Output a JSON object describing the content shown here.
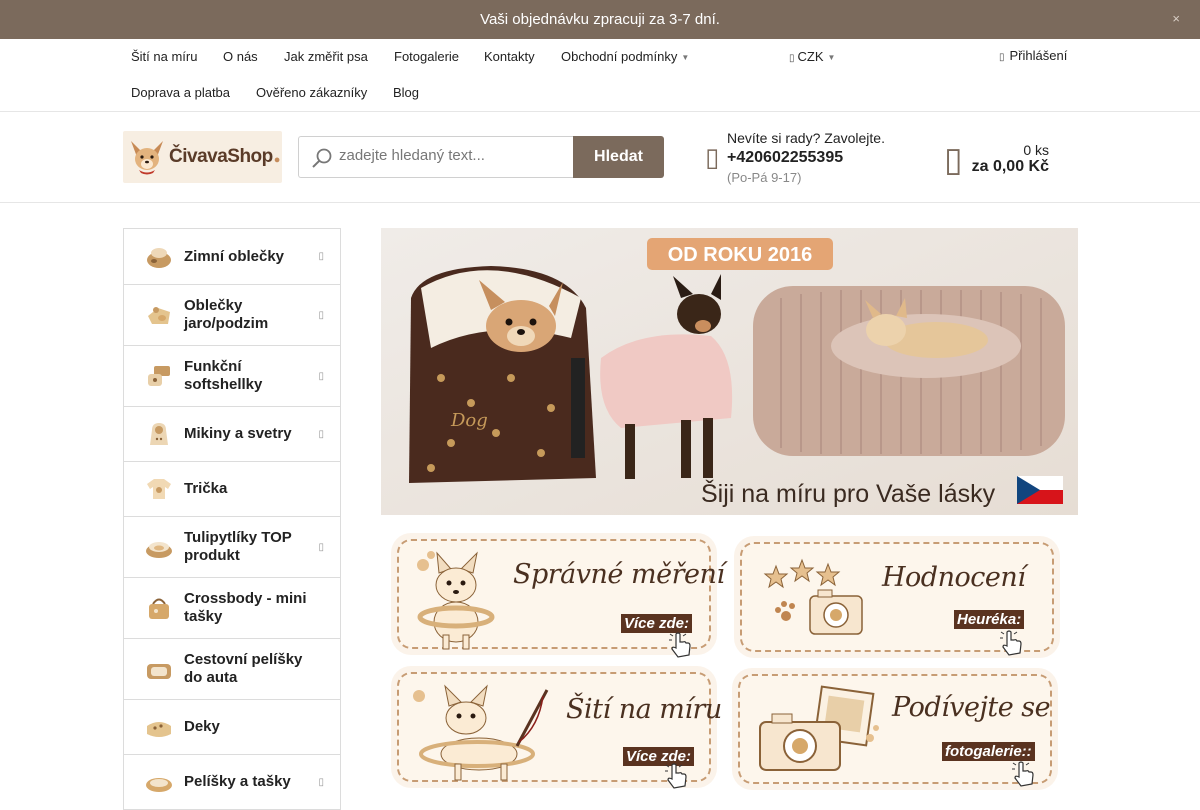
{
  "announcement": {
    "text": "Vaši objednávku zpracuji za 3-7 dní.",
    "close_glyph": "×"
  },
  "topnav": {
    "row1": [
      "Šití na míru",
      "O nás",
      "Jak změřit psa",
      "Fotogalerie",
      "Kontakty",
      "Obchodní podmínky"
    ],
    "row2": [
      "Doprava a platba",
      "Ověřeno zákazníky",
      "Blog"
    ],
    "currency": "CZK",
    "login": "Přihlášení"
  },
  "header": {
    "logo_text": "ČivavaShop",
    "search": {
      "placeholder": "zadejte hledaný text...",
      "value": "",
      "button": "Hledat"
    },
    "contact": {
      "question": "Nevíte si rady? Zavolejte.",
      "phone": "+420602255395",
      "hours": "(Po-Pá 9-17)"
    },
    "cart": {
      "count": "0 ks",
      "total": "za 0,00 Kč"
    }
  },
  "categories": [
    {
      "label": "Zimní oblečky",
      "icon": "winter-clothes-icon",
      "has_sub": true
    },
    {
      "label": "Oblečky jaro/podzim",
      "icon": "spring-clothes-icon",
      "has_sub": true
    },
    {
      "label": "Funkční softshellky",
      "icon": "softshell-icon",
      "has_sub": true
    },
    {
      "label": "Mikiny a svetry",
      "icon": "hoodie-icon",
      "has_sub": true
    },
    {
      "label": "Trička",
      "icon": "tshirt-icon",
      "has_sub": false
    },
    {
      "label": "Tulipytlíky TOP produkt",
      "icon": "bag-bed-icon",
      "has_sub": true
    },
    {
      "label": "Crossbody - mini tašky",
      "icon": "crossbody-icon",
      "has_sub": false
    },
    {
      "label": "Cestovní pelíšky do auta",
      "icon": "car-bed-icon",
      "has_sub": false
    },
    {
      "label": "Deky",
      "icon": "blanket-icon",
      "has_sub": false
    },
    {
      "label": "Pelíšky a tašky",
      "icon": "dog-bed-icon",
      "has_sub": true
    }
  ],
  "hero": {
    "badge": "OD ROKU 2016",
    "caption": "Šiji na míru pro Vaše lásky"
  },
  "tiles": [
    {
      "title": "Správné měření",
      "cta": "Více zde:"
    },
    {
      "title": "Hodnocení",
      "cta": "Heuréka:"
    },
    {
      "title": "Šití na míru",
      "cta": "Více zde:"
    },
    {
      "title": "Podívejte se",
      "cta": "fotogalerie::"
    }
  ],
  "colors": {
    "brand": "#7b6a5c",
    "tile_accent": "#5a3320",
    "tile_bg": "#fdf6ec"
  }
}
